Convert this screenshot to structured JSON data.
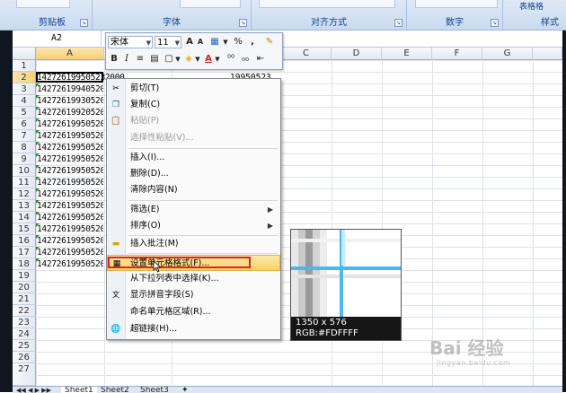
{
  "ribbon": {
    "groups": [
      {
        "label": "剪贴板"
      },
      {
        "label": "字体"
      },
      {
        "label": "对齐方式"
      },
      {
        "label": "数字"
      },
      {
        "label": "样式"
      }
    ],
    "top_right_label": "表格格"
  },
  "formula_bar": {
    "name_box": "A2"
  },
  "columns": [
    "A",
    "B",
    "C",
    "D",
    "E",
    "F",
    "G"
  ],
  "rows": [
    "1",
    "2",
    "3",
    "4",
    "5",
    "6",
    "7",
    "8",
    "9",
    "10",
    "11",
    "12",
    "13",
    "14",
    "15",
    "16",
    "17",
    "18",
    "19",
    "20",
    "21",
    "22",
    "23",
    "24",
    "25",
    "26",
    "27"
  ],
  "cells": {
    "A2": "142726199505232000",
    "A3": "14272619940520",
    "A4": "14272619930520",
    "A5": "14272619920520",
    "A6": "14272619950520",
    "A7": "14272619950520",
    "A8": "14272619950520",
    "A9": "14272619950520",
    "A10": "14272619950520",
    "A11": "14272619950520",
    "A12": "14272619950520",
    "A13": "14272619950520",
    "A14": "14272619950520",
    "A15": "14272619950520",
    "A16": "14272619950520",
    "A17": "14272619950520",
    "A18": "14272619950520",
    "B2": "19950523"
  },
  "mini_toolbar": {
    "font_name": "宋体",
    "font_size": "11",
    "grow_font": "A",
    "shrink_font": "A",
    "percent": "%",
    "comma": ",",
    "bold": "B",
    "italic": "I",
    "font_color_label": "A"
  },
  "context_menu": {
    "items": [
      {
        "label": "剪切(T)",
        "icon": "scissors-icon"
      },
      {
        "label": "复制(C)",
        "icon": "copy-icon"
      },
      {
        "label": "粘贴(P)",
        "icon": "paste-icon",
        "disabled": true
      },
      {
        "label": "选择性粘贴(V)...",
        "disabled": true
      },
      {
        "label": "插入(I)..."
      },
      {
        "label": "删除(D)..."
      },
      {
        "label": "清除内容(N)"
      },
      {
        "label": "筛选(E)",
        "submenu": true
      },
      {
        "label": "排序(O)",
        "submenu": true
      },
      {
        "label": "插入批注(M)",
        "icon": "comment-icon"
      },
      {
        "label": "设置单元格格式(F)...",
        "icon": "format-cells-icon",
        "highlighted": true
      },
      {
        "label": "从下拉列表中选择(K)..."
      },
      {
        "label": "显示拼音字段(S)",
        "icon": "phonetic-icon"
      },
      {
        "label": "命名单元格区域(R)..."
      },
      {
        "label": "超链接(H)...",
        "icon": "hyperlink-icon"
      }
    ]
  },
  "zoom_tooltip": {
    "coords": "1350 x 576",
    "rgb": "RGB:#FDFFFF"
  },
  "sheet_tabs": [
    "Sheet1",
    "Sheet2",
    "Sheet3"
  ],
  "watermark": {
    "text": "Bai 经验",
    "url": "jingyan.baidu.com"
  },
  "colors": {
    "highlight": "#f8d365",
    "red_box": "#e0222a",
    "zoom_line": "#4ab8ee"
  }
}
